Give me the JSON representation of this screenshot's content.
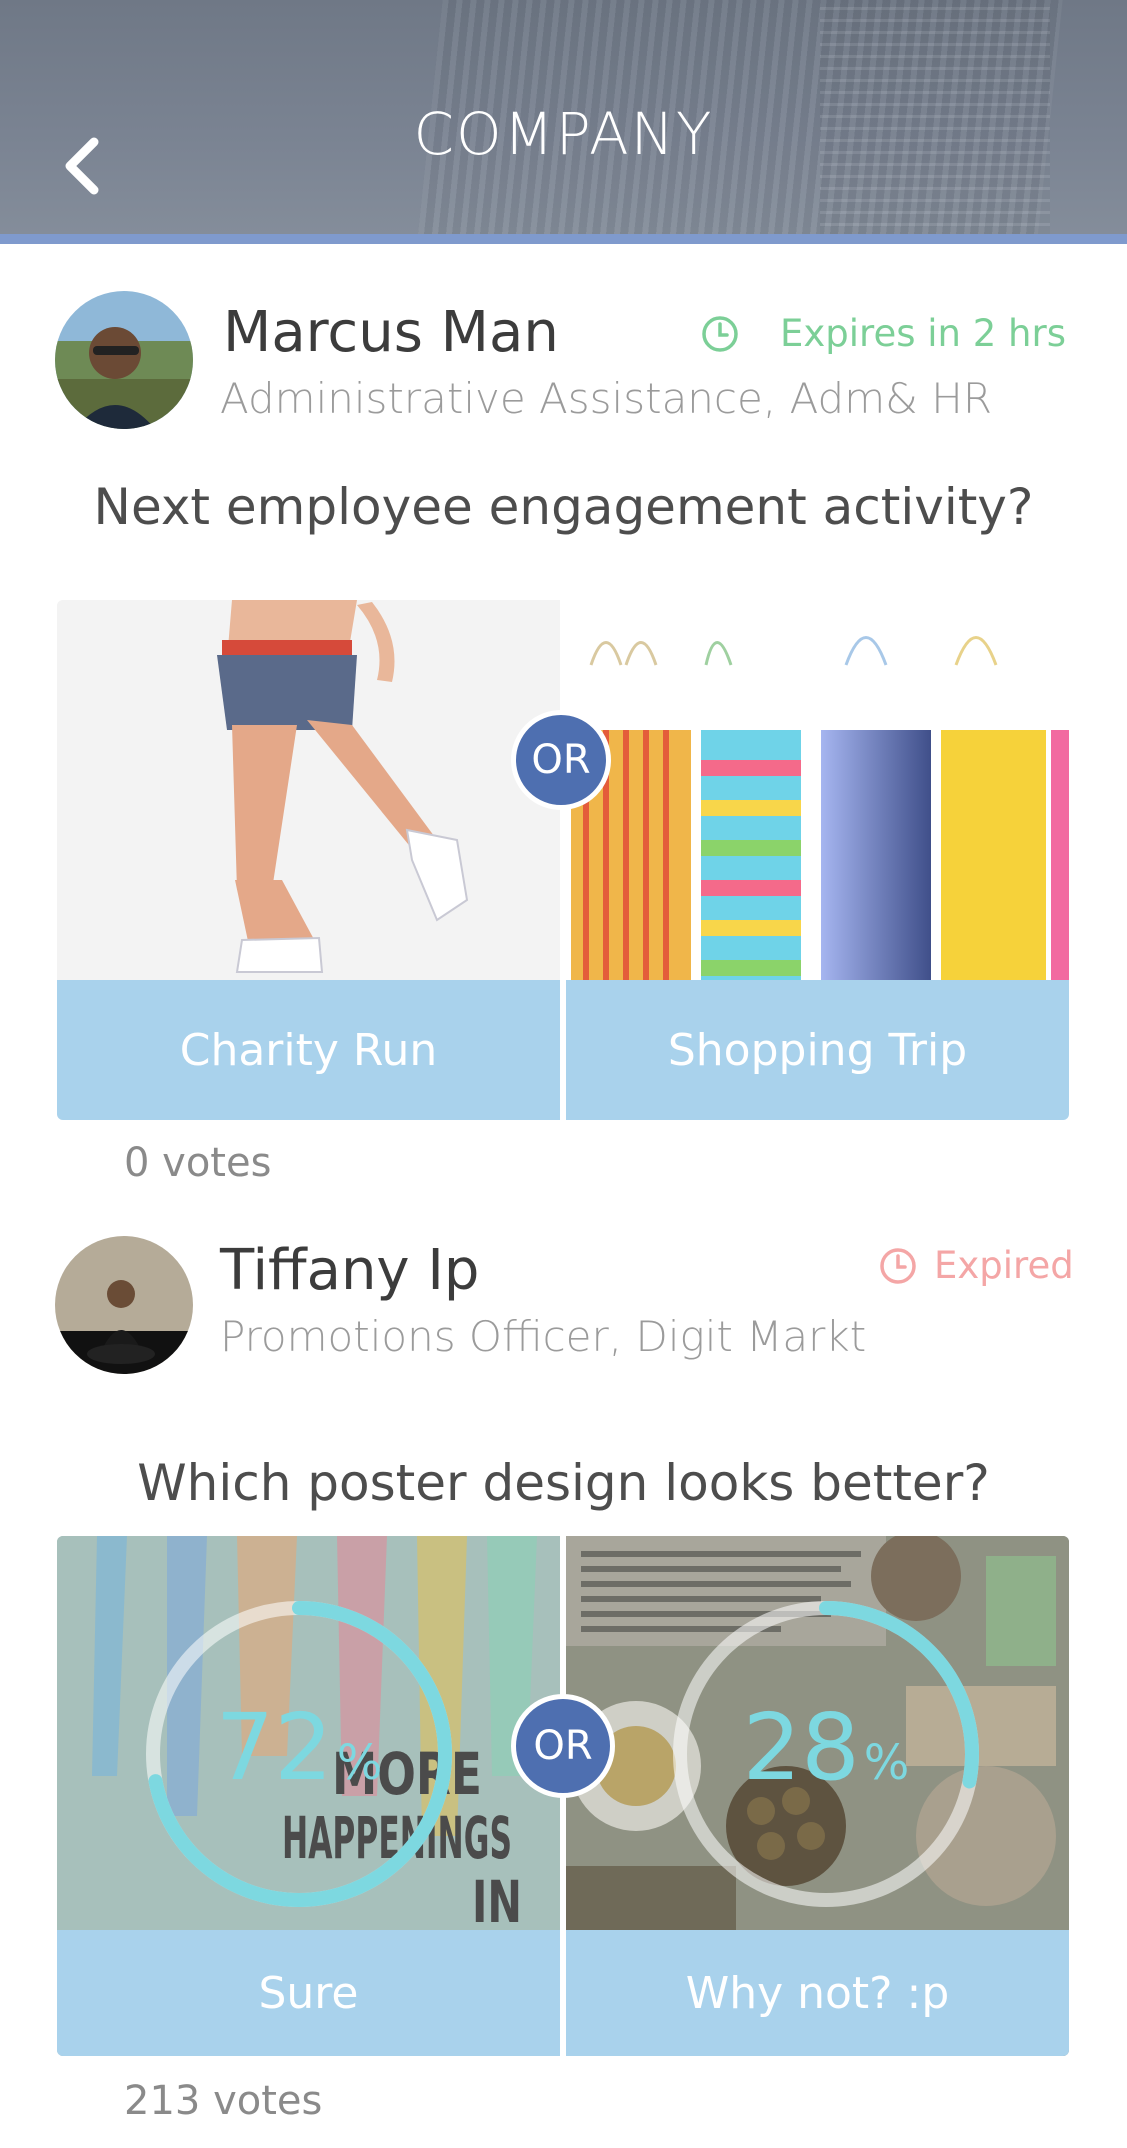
{
  "header": {
    "title": "COMPANY",
    "back_icon": "chevron-left-icon"
  },
  "posts": [
    {
      "author": "Marcus Man",
      "role": "Administrative Assistance, Adm& HR",
      "status": "Expires in 2 hrs",
      "status_color": "#7ccf97",
      "question": "Next employee engagement activity?",
      "options": [
        {
          "label": "Charity Run"
        },
        {
          "label": "Shopping Trip"
        }
      ],
      "or_label": "OR",
      "votes": "0 votes"
    },
    {
      "author": "Tiffany Ip",
      "role": "Promotions Officer, Digit Markt",
      "status": "Expired",
      "status_color": "#f4a6a6",
      "question": "Which poster design looks better?",
      "options": [
        {
          "label": "Sure",
          "percent": "72",
          "percent_value": 72
        },
        {
          "label": "Why not? :p",
          "percent": "28",
          "percent_value": 28
        }
      ],
      "percent_sign": "%",
      "poster_text": [
        "MORE",
        "HAPPENINGS",
        "IN"
      ],
      "or_label": "OR",
      "votes": "213 votes"
    }
  ],
  "colors": {
    "accent": "#4e6fb0",
    "label_bg": "#a9d2ec",
    "percent": "#7dd8e0"
  }
}
